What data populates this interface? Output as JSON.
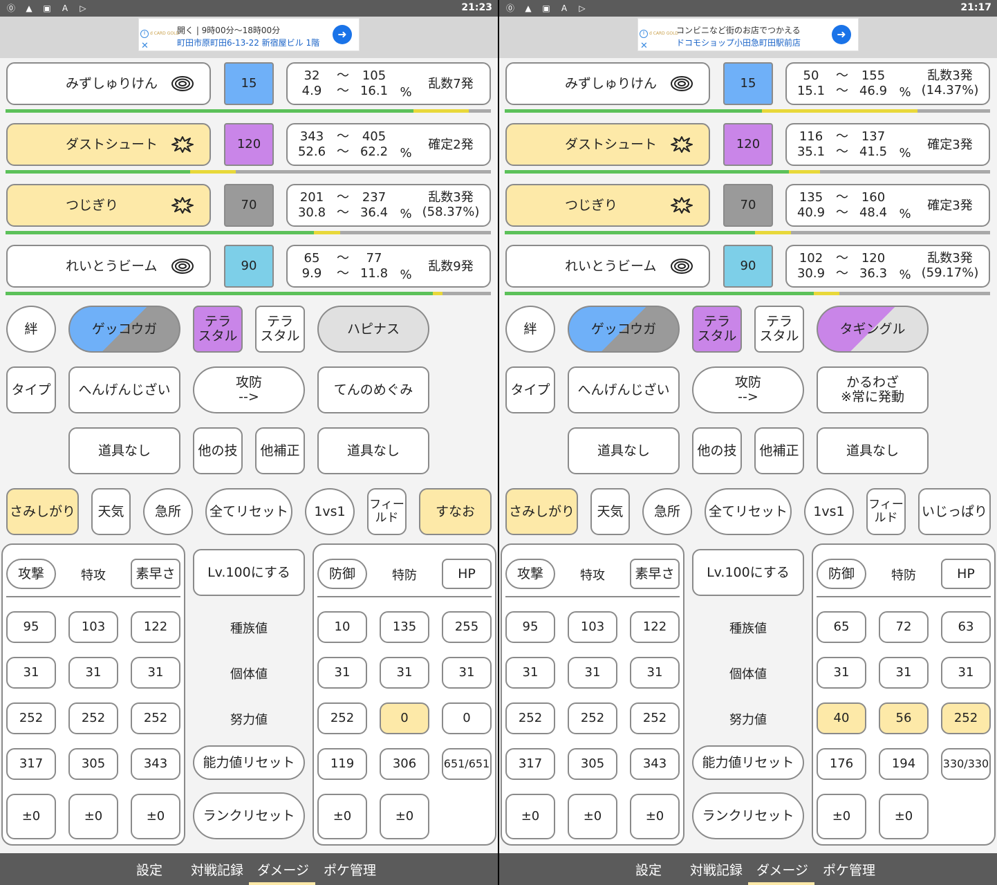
{
  "panels": [
    {
      "status": {
        "time": "21:23"
      },
      "ad": {
        "line1": "開く | 9時00分〜18時00分",
        "line2": "町田市原町田6-13-22 新宿屋ビル 1階",
        "brand": "d CARD GOLD"
      },
      "moves": [
        {
          "name": "みずしゅりけん",
          "category": "special",
          "power": "15",
          "dmin": "32",
          "dmax": "105",
          "pmin": "4.9",
          "pmax": "16.1",
          "result": "乱数7発",
          "result2": ""
        },
        {
          "name": "ダストシュート",
          "category": "physical",
          "power": "120",
          "dmin": "343",
          "dmax": "405",
          "pmin": "52.6",
          "pmax": "62.2",
          "result": "確定2発",
          "result2": ""
        },
        {
          "name": "つじぎり",
          "category": "physical",
          "power": "70",
          "dmin": "201",
          "dmax": "237",
          "pmin": "30.8",
          "pmax": "36.4",
          "result": "乱数3発",
          "result2": "(58.37%)"
        },
        {
          "name": "れいとうビーム",
          "category": "special",
          "power": "90",
          "dmin": "65",
          "dmax": "77",
          "pmin": "9.9",
          "pmax": "11.8",
          "result": "乱数9発",
          "result2": ""
        }
      ],
      "hpbars": [
        {
          "green": 0.84,
          "ystart": 0.84,
          "yend": 0.955
        },
        {
          "green": 0.38,
          "ystart": 0.38,
          "yend": 0.475
        },
        {
          "green": 0.635,
          "ystart": 0.635,
          "yend": 0.69
        },
        {
          "green": 0.88,
          "ystart": 0.88,
          "yend": 0.9
        }
      ],
      "row1": {
        "kizuna": "絆",
        "attacker": "ゲッコウガ",
        "tera1": "テラ\nスタル",
        "tera2": "テラ\nスタル",
        "defender": "ハピナス"
      },
      "row2": {
        "type": "タイプ",
        "ability_atk": "へんげんじざい",
        "swap": "攻防\n-->",
        "ability_def": "てんのめぐみ"
      },
      "row3": {
        "item_atk": "道具なし",
        "other_move": "他の技",
        "other_mod": "他補正",
        "item_def": "道具なし"
      },
      "row4": {
        "nature_atk": "さみしがり",
        "weather": "天気",
        "crit": "急所",
        "reset_all": "全てリセット",
        "vs": "1vs1",
        "field": "フィー\nルド",
        "nature_def": "すなお"
      },
      "atk_tabs": [
        "攻撃",
        "特攻",
        "素早さ"
      ],
      "def_tabs": [
        "防御",
        "特防",
        "HP"
      ],
      "middle": {
        "lv100": "Lv.100にする",
        "base": "種族値",
        "iv": "個体値",
        "ev": "努力値",
        "stat_reset": "能力値リセット",
        "rank_reset": "ランクリセット"
      },
      "atk_grid": [
        [
          "95",
          "103",
          "122"
        ],
        [
          "31",
          "31",
          "31"
        ],
        [
          "252",
          "252",
          "252"
        ],
        [
          "317",
          "305",
          "343"
        ],
        [
          "±0",
          "±0",
          "±0"
        ]
      ],
      "def_grid": [
        [
          "10",
          "135",
          "255"
        ],
        [
          "31",
          "31",
          "31"
        ],
        [
          "252",
          "0",
          "0"
        ],
        [
          "119",
          "306",
          "651/651"
        ],
        [
          "±0",
          "±0",
          ""
        ]
      ],
      "def_ev_highlight": [
        false,
        true,
        false
      ],
      "nav": [
        "設定",
        "対戦記録",
        "ダメージ",
        "ポケ管理"
      ]
    },
    {
      "status": {
        "time": "21:17"
      },
      "ad": {
        "line1": "コンビニなど街のお店でつかえる",
        "line2": "ドコモショップ小田急町田駅前店",
        "brand": "d CARD GOLD"
      },
      "moves": [
        {
          "name": "みずしゅりけん",
          "category": "special",
          "power": "15",
          "dmin": "50",
          "dmax": "155",
          "pmin": "15.1",
          "pmax": "46.9",
          "result": "乱数3発",
          "result2": "(14.37%)"
        },
        {
          "name": "ダストシュート",
          "category": "physical",
          "power": "120",
          "dmin": "116",
          "dmax": "137",
          "pmin": "35.1",
          "pmax": "41.5",
          "result": "確定3発",
          "result2": ""
        },
        {
          "name": "つじぎり",
          "category": "physical",
          "power": "70",
          "dmin": "135",
          "dmax": "160",
          "pmin": "40.9",
          "pmax": "48.4",
          "result": "確定3発",
          "result2": ""
        },
        {
          "name": "れいとうビーム",
          "category": "special",
          "power": "90",
          "dmin": "102",
          "dmax": "120",
          "pmin": "30.9",
          "pmax": "36.3",
          "result": "乱数3発",
          "result2": "(59.17%)"
        }
      ],
      "hpbars": [
        {
          "green": 0.53,
          "ystart": 0.53,
          "yend": 0.85
        },
        {
          "green": 0.585,
          "ystart": 0.585,
          "yend": 0.65
        },
        {
          "green": 0.515,
          "ystart": 0.515,
          "yend": 0.59
        },
        {
          "green": 0.637,
          "ystart": 0.637,
          "yend": 0.69
        }
      ],
      "row1": {
        "kizuna": "絆",
        "attacker": "ゲッコウガ",
        "tera1": "テラ\nスタル",
        "tera2": "テラ\nスタル",
        "defender": "タギングル"
      },
      "row2": {
        "type": "タイプ",
        "ability_atk": "へんげんじざい",
        "swap": "攻防\n-->",
        "ability_def": "かるわざ\n※常に発動"
      },
      "row3": {
        "item_atk": "道具なし",
        "other_move": "他の技",
        "other_mod": "他補正",
        "item_def": "道具なし"
      },
      "row4": {
        "nature_atk": "さみしがり",
        "weather": "天気",
        "crit": "急所",
        "reset_all": "全てリセット",
        "vs": "1vs1",
        "field": "フィー\nルド",
        "nature_def": "いじっぱり"
      },
      "atk_tabs": [
        "攻撃",
        "特攻",
        "素早さ"
      ],
      "def_tabs": [
        "防御",
        "特防",
        "HP"
      ],
      "middle": {
        "lv100": "Lv.100にする",
        "base": "種族値",
        "iv": "個体値",
        "ev": "努力値",
        "stat_reset": "能力値リセット",
        "rank_reset": "ランクリセット"
      },
      "atk_grid": [
        [
          "95",
          "103",
          "122"
        ],
        [
          "31",
          "31",
          "31"
        ],
        [
          "252",
          "252",
          "252"
        ],
        [
          "317",
          "305",
          "343"
        ],
        [
          "±0",
          "±0",
          "±0"
        ]
      ],
      "def_grid": [
        [
          "65",
          "72",
          "63"
        ],
        [
          "31",
          "31",
          "31"
        ],
        [
          "40",
          "56",
          "252"
        ],
        [
          "176",
          "194",
          "330/330"
        ],
        [
          "±0",
          "±0",
          ""
        ]
      ],
      "def_ev_highlight": [
        true,
        true,
        true
      ],
      "nav": [
        "設定",
        "対戦記録",
        "ダメージ",
        "ポケ管理"
      ]
    }
  ],
  "colors": {
    "water": "#6fb0f8",
    "poison": "#c985e8",
    "dark": "#9a9a9a",
    "ice": "#7dcfe8",
    "highlight": "#fde9a8",
    "hp_green": "#5cc15a",
    "hp_yellow": "#e8d83a"
  },
  "icons": {
    "special": "target-ring-icon",
    "physical": "burst-icon"
  }
}
